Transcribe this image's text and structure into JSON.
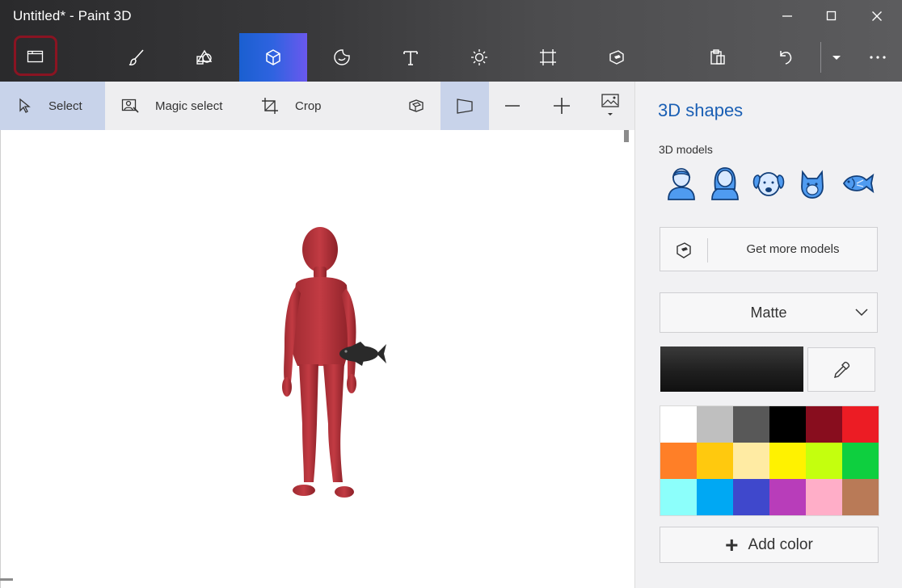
{
  "window": {
    "title": "Untitled* - Paint 3D"
  },
  "toolbar": {
    "active_tool": "3d-shapes"
  },
  "subbar": {
    "select_label": "Select",
    "magic_select_label": "Magic select",
    "crop_label": "Crop"
  },
  "panel": {
    "title": "3D shapes",
    "models_label": "3D models",
    "models": [
      "man",
      "woman",
      "dog",
      "cat",
      "fish"
    ],
    "get_more_label": "Get more models",
    "material": "Matte",
    "current_color": "#1f1f1f",
    "add_color_label": "Add color",
    "palette": [
      "#ffffff",
      "#bfbfbf",
      "#585858",
      "#000000",
      "#880d1e",
      "#ec1c24",
      "#ff7f27",
      "#ffc90e",
      "#ffeba3",
      "#fff200",
      "#c4ff0e",
      "#0ecf3f",
      "#8cfffb",
      "#00a8f3",
      "#3f48cc",
      "#b83dba",
      "#ffaec8",
      "#b97a57"
    ]
  },
  "colors": {
    "accent": "#1a5fb4",
    "menu_highlight": "#8a1422",
    "person_model": "#b83239",
    "fish_model": "#2a2a2a"
  }
}
